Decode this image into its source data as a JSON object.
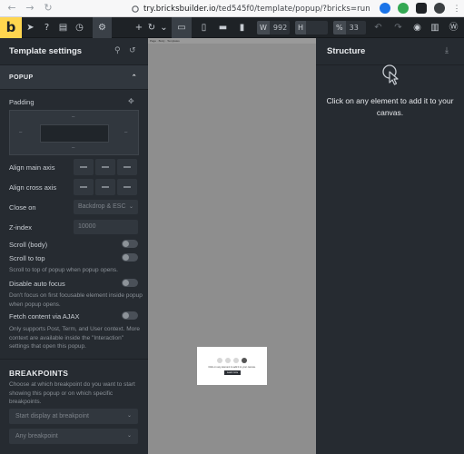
{
  "browser": {
    "url_host": "try.bricksbuilder.io",
    "url_path": "/ted545f0/template/popup/?bricks=run"
  },
  "toolbar": {
    "logo": "b",
    "width_label": "W",
    "width_value": "992",
    "height_label": "H",
    "zoom_label": "%",
    "zoom_value": "33"
  },
  "panel": {
    "title": "Template settings",
    "section": "POPUP",
    "padding_label": "Padding",
    "align_main_label": "Align main axis",
    "align_cross_label": "Align cross axis",
    "close_on_label": "Close on",
    "close_on_value": "Backdrop & ESC",
    "zindex_label": "Z-index",
    "zindex_placeholder": "10000",
    "scroll_body_label": "Scroll (body)",
    "scroll_top_label": "Scroll to top",
    "scroll_top_hint": "Scroll to top of popup when popup opens.",
    "disable_focus_label": "Disable auto focus",
    "disable_focus_hint": "Don't focus on first focusable element inside popup when popup opens.",
    "fetch_ajax_label": "Fetch content via AJAX",
    "fetch_ajax_hint": "Only supports Post, Term, and User context. More context are available inside the \"Interaction\" settings that open this popup.",
    "breakpoints_heading": "BREAKPOINTS",
    "breakpoints_hint": "Choose at which breakpoint do you want to start showing this popup or on which specific breakpoints.",
    "start_breakpoint_placeholder": "Start display at breakpoint",
    "any_breakpoint_placeholder": "Any breakpoint"
  },
  "canvas": {
    "breadcrumb": "Page  ·  Body  ·  Templates",
    "popup_text": "Click on any element to add it to your canvas.",
    "popup_button": "Learn more"
  },
  "structure": {
    "title": "Structure",
    "message": "Click on any element to add it to your canvas."
  }
}
